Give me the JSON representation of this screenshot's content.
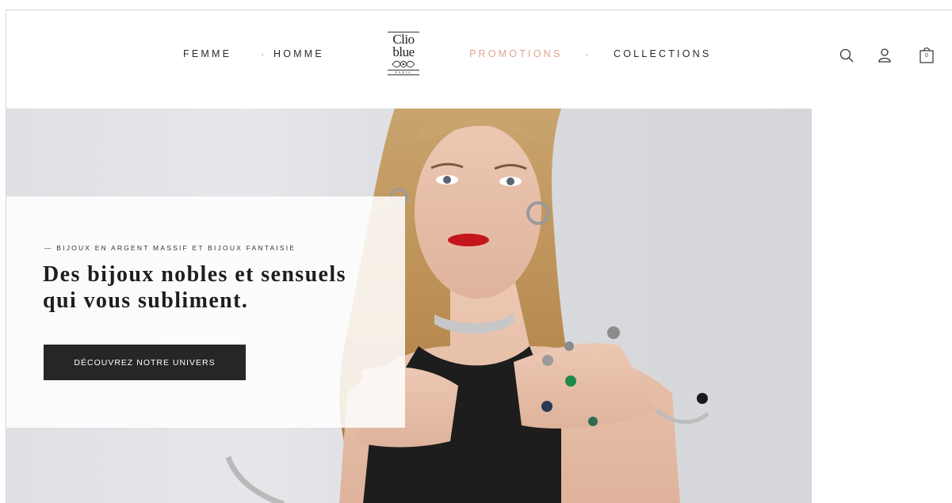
{
  "header": {
    "nav_left": [
      "FEMME",
      "HOMME"
    ],
    "nav_right": [
      "PROMOTIONS",
      "COLLECTIONS"
    ],
    "separator": "·",
    "logo": {
      "line1": "Clio",
      "line2": "blue",
      "tagline": "PARIS"
    },
    "icons": [
      "search-icon",
      "account-icon",
      "cart-icon"
    ],
    "cart_count": "0",
    "colors": {
      "promo": "#e0a48c",
      "text": "#2a2a2a"
    }
  },
  "hero": {
    "kicker": "— BIJOUX EN ARGENT MASSIF ET BIJOUX FANTAISIE",
    "headline": "Des bijoux nobles et sensuels qui vous subliment.",
    "cta_label": "DÉCOUVREZ NOTRE UNIVERS",
    "colors": {
      "cta_bg": "#262626",
      "overlay": "rgba(255,255,255,0.86)"
    }
  }
}
